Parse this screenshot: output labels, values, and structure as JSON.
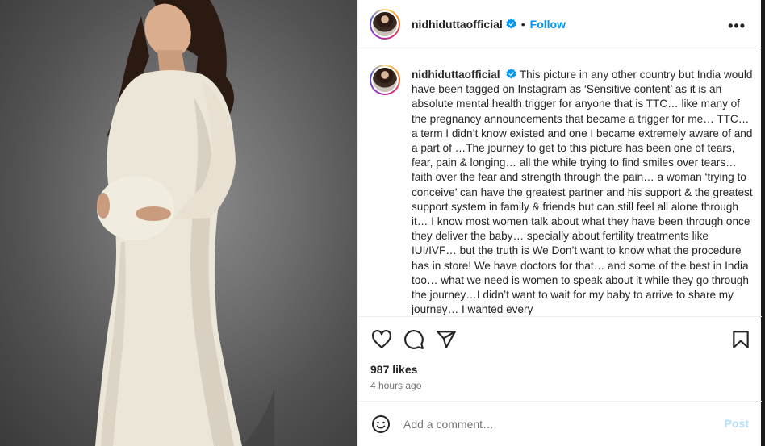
{
  "post": {
    "username": "nidhiduttaofficial",
    "verified_icon": "verified-badge-icon",
    "separator": "•",
    "follow_label": "Follow",
    "more_label": "•••",
    "caption_username": "nidhiduttaofficial",
    "caption": "This picture in any other country but India would have been tagged on Instagram as ‘Sensitive content’ as it is an absolute mental health trigger for anyone that is TTC… like many of the pregnancy announcements that became a trigger for me… TTC… a term I didn’t know existed and one I became extremely aware of and a part of …The journey to get to this picture has been one of tears, fear, pain & longing… all the while trying to find smiles over tears… faith over the fear and strength through the pain… a woman ‘trying to conceive’ can have the greatest partner and his support & the greatest support system in family & friends but can still feel all alone through it… I know most women talk about what they have been through once they deliver the baby… specially about fertility treatments like IUI/IVF… but the truth is We Don’t want to know what the procedure has in store! We have doctors for that… and some of the best in India too… what we need is women to speak about it while they go through the journey…I didn’t want to wait for my baby to arrive to share my journey… I wanted every",
    "likes": "987 likes",
    "timestamp": "4 hours ago"
  },
  "actions": {
    "icons": [
      "heart-icon",
      "comment-icon",
      "share-icon",
      "bookmark-icon"
    ]
  },
  "comment": {
    "placeholder": "Add a comment…",
    "post_label": "Post"
  },
  "colors": {
    "accent": "#0095f6",
    "post_disabled": "#b2dffc",
    "text": "#262626",
    "muted": "#737373"
  }
}
